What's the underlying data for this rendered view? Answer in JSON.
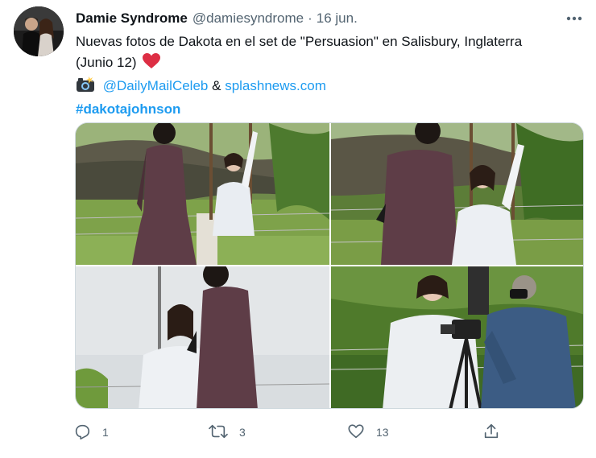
{
  "tweet": {
    "display_name": "Damie Syndrome",
    "handle": "@damiesyndrome",
    "separator": "·",
    "date": "16 jun.",
    "text_line1": "Nuevas fotos de Dakota en el set de \"Persuasion\" en Salisbury, Inglaterra",
    "text_line2": "(Junio 12)",
    "heart_emoji": "red-heart",
    "camera_emoji": "camera-with-flash",
    "credit_link1": "@DailyMailCeleb",
    "credit_amp": "&",
    "credit_link2": "splashnews.com",
    "hashtag": "#dakotajohnson"
  },
  "media": {
    "photo_count": 4,
    "photos": [
      "photo-1",
      "photo-2",
      "photo-3",
      "photo-4"
    ]
  },
  "actions": {
    "reply_count": "1",
    "retweet_count": "3",
    "like_count": "13"
  },
  "icons": {
    "more": "more-horizontal-icon",
    "reply": "reply-icon",
    "retweet": "retweet-icon",
    "like": "heart-icon",
    "share": "share-icon"
  },
  "colors": {
    "text_primary": "#0f1419",
    "text_secondary": "#536471",
    "link": "#1d9bf0",
    "heart": "#e0245e",
    "divider": "#cfd9de"
  }
}
